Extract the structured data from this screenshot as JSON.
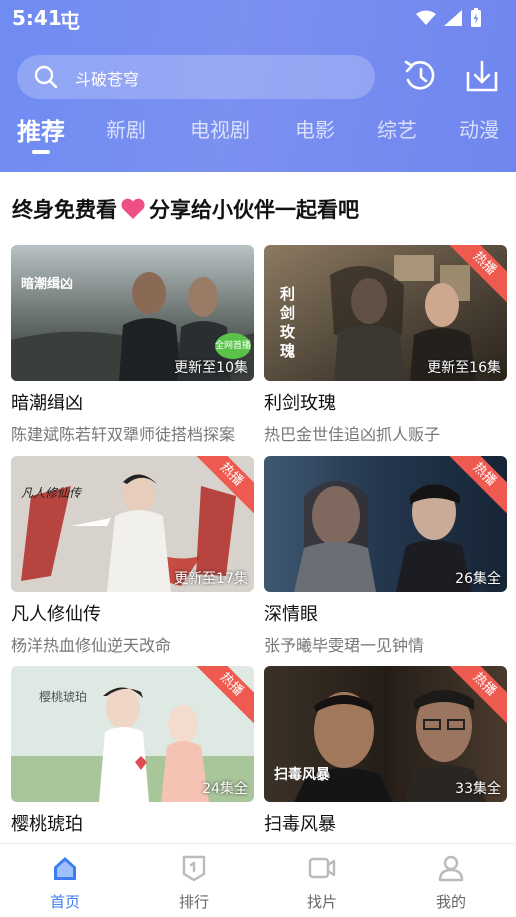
{
  "status": {
    "time": "5:41",
    "carrier": "屯"
  },
  "search": {
    "placeholder": "斗破苍穹"
  },
  "tabs": [
    "推荐",
    "新剧",
    "电视剧",
    "电影",
    "综艺",
    "动漫"
  ],
  "promo": {
    "text_before": "终身免费看",
    "text_after": "分享给小伙伴一起看吧",
    "heart_color": "#ee4f87"
  },
  "colors": {
    "accent": "#3d7df2",
    "hot": "#ee5a4f",
    "header_start": "#6f8cf3",
    "header_end": "#6f86ee"
  },
  "cards": [
    {
      "title": "暗潮缉凶",
      "subtitle": "陈建斌陈若轩双犟师徒搭档探案",
      "episodes": "更新至10集",
      "hot": false,
      "badge": "全网首播",
      "poster_text": "暗潮缉凶"
    },
    {
      "title": "利剑玫瑰",
      "subtitle": "热巴金世佳追凶抓人贩子",
      "episodes": "更新至16集",
      "hot": true,
      "hot_label": "热播",
      "poster_text": "利剑玫瑰"
    },
    {
      "title": "凡人修仙传",
      "subtitle": "杨洋热血修仙逆天改命",
      "episodes": "更新至17集",
      "hot": true,
      "hot_label": "热播",
      "poster_text": "凡人修仙传"
    },
    {
      "title": "深情眼",
      "subtitle": "张予曦毕雯珺一见钟情",
      "episodes": "26集全",
      "hot": true,
      "hot_label": "热播"
    },
    {
      "title": "樱桃琥珀",
      "subtitle": "",
      "episodes": "24集全",
      "hot": true,
      "hot_label": "热播",
      "poster_text": "樱桃琥珀"
    },
    {
      "title": "扫毒风暴",
      "subtitle": "",
      "episodes": "33集全",
      "hot": true,
      "hot_label": "热播",
      "poster_text": "扫毒风暴"
    }
  ],
  "nav": [
    {
      "label": "首页",
      "icon": "home-icon",
      "active": true
    },
    {
      "label": "排行",
      "icon": "ranking-icon",
      "active": false
    },
    {
      "label": "找片",
      "icon": "video-icon",
      "active": false
    },
    {
      "label": "我的",
      "icon": "profile-icon",
      "active": false
    }
  ]
}
